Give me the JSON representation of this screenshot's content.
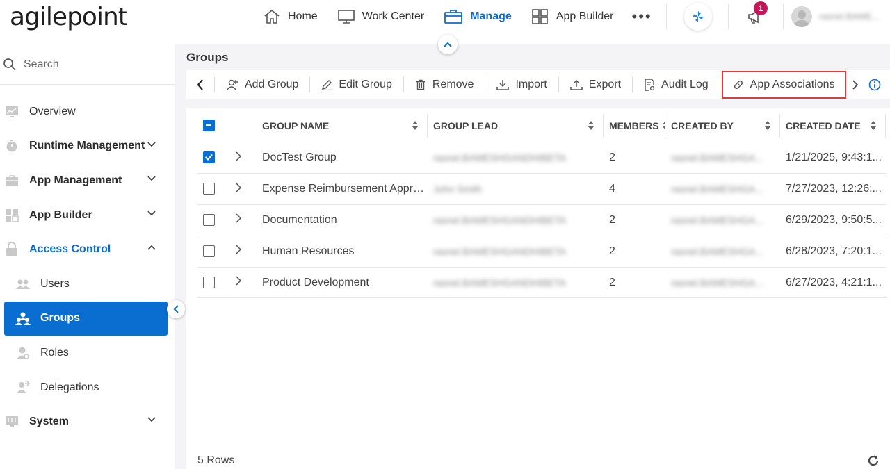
{
  "header": {
    "logo": "agilepoint",
    "nav": [
      {
        "label": "Home",
        "icon": "home-icon"
      },
      {
        "label": "Work Center",
        "icon": "monitor-icon"
      },
      {
        "label": "Manage",
        "icon": "briefcase-icon",
        "active": true
      },
      {
        "label": "App Builder",
        "icon": "grid-icon"
      }
    ],
    "more": "•••",
    "notification_count": "1",
    "username": "rasnel.BAME..."
  },
  "sidebar": {
    "search_placeholder": "Search",
    "items": [
      {
        "label": "Overview",
        "icon": "chart-icon"
      },
      {
        "label": "Runtime Management",
        "icon": "stopwatch-icon"
      },
      {
        "label": "App Management",
        "icon": "briefcase-icon"
      },
      {
        "label": "App Builder",
        "icon": "grid-icon"
      },
      {
        "label": "Access Control",
        "icon": "lock-icon"
      }
    ],
    "access_control_children": [
      {
        "label": "Users",
        "icon": "users-icon"
      },
      {
        "label": "Groups",
        "icon": "groups-icon"
      },
      {
        "label": "Roles",
        "icon": "role-icon"
      },
      {
        "label": "Delegations",
        "icon": "delegation-icon"
      }
    ],
    "system": {
      "label": "System",
      "icon": "system-icon"
    }
  },
  "main": {
    "title": "Groups",
    "toolbar": {
      "add_group": "Add Group",
      "edit_group": "Edit Group",
      "remove": "Remove",
      "import": "Import",
      "export": "Export",
      "audit_log": "Audit Log",
      "app_associations": "App Associations"
    },
    "table": {
      "columns": {
        "group_name": "GROUP NAME",
        "group_lead": "GROUP LEAD",
        "members": "MEMBERS",
        "created_by": "CREATED BY",
        "created_date": "CREATED DATE"
      },
      "rows": [
        {
          "name": "DocTest Group",
          "lead": "rasnel.BAMESHGANDHIBETA",
          "members": "2",
          "created_by": "rasnel.BAMESHGA...",
          "created_date": "1/21/2025, 9:43:1...",
          "checked": true
        },
        {
          "name": "Expense Reimbursement Appro...",
          "lead": "John Smith",
          "members": "4",
          "created_by": "rasnel.BAMESHGA...",
          "created_date": "7/27/2023, 12:26:...",
          "checked": false
        },
        {
          "name": "Documentation",
          "lead": "rasnel.BAMESHGANDHIBETA",
          "members": "2",
          "created_by": "rasnel.BAMESHGA...",
          "created_date": "6/29/2023, 9:50:5...",
          "checked": false
        },
        {
          "name": "Human Resources",
          "lead": "rasnel.BAMESHGANDHIBETA",
          "members": "2",
          "created_by": "rasnel.BAMESHGA...",
          "created_date": "6/28/2023, 7:20:1...",
          "checked": false
        },
        {
          "name": "Product Development",
          "lead": "rasnel.BAMESHGANDHIBETA",
          "members": "2",
          "created_by": "rasnel.BAMESHGA...",
          "created_date": "6/27/2023, 4:21:1...",
          "checked": false
        }
      ]
    },
    "row_count": "5 Rows"
  },
  "colors": {
    "accent": "#0a6ed1",
    "badge": "#c2185b",
    "highlight_border": "#e53935"
  }
}
